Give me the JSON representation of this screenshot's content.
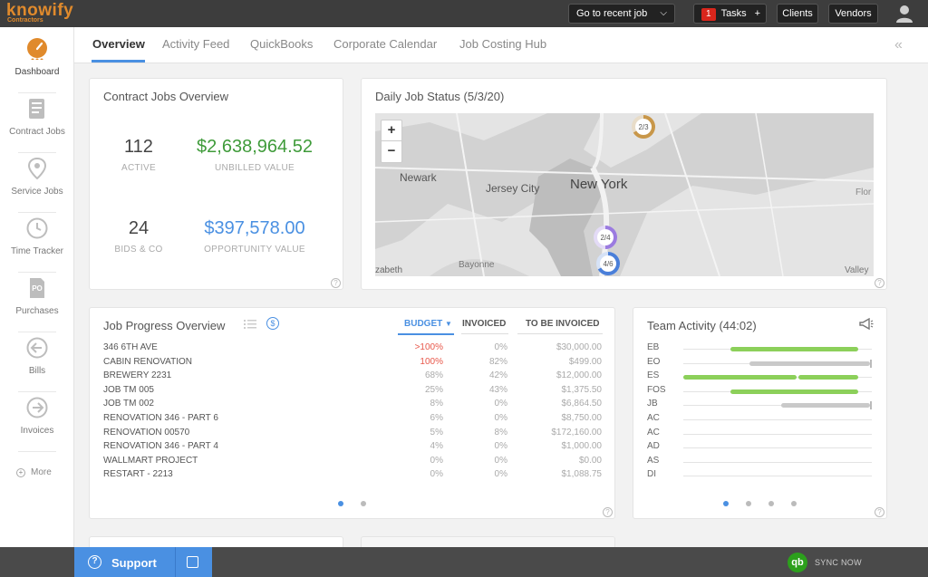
{
  "app": {
    "logo_text": "knowify",
    "logo_sub": "Contractors"
  },
  "topbar": {
    "recent_job_label": "Go to recent job",
    "tasks_count": "1",
    "tasks_label": "Tasks",
    "tasks_plus": "+",
    "clients_label": "Clients",
    "vendors_label": "Vendors"
  },
  "sidebar": {
    "items": [
      {
        "label": "Dashboard",
        "icon": "dashboard-gauge-icon"
      },
      {
        "label": "Contract Jobs",
        "icon": "document-dollar-icon"
      },
      {
        "label": "Service Jobs",
        "icon": "map-pin-icon"
      },
      {
        "label": "Time Tracker",
        "icon": "clock-icon"
      },
      {
        "label": "Purchases",
        "icon": "po-document-icon"
      },
      {
        "label": "Bills",
        "icon": "arrow-left-circle-icon"
      },
      {
        "label": "Invoices",
        "icon": "arrow-right-circle-icon"
      }
    ],
    "more_label": "More"
  },
  "tabs": [
    "Overview",
    "Activity Feed",
    "QuickBooks",
    "Corporate Calendar",
    "Job Costing Hub"
  ],
  "contract_jobs": {
    "title": "Contract Jobs Overview",
    "active_count": "112",
    "active_label": "ACTIVE",
    "unbilled_value": "$2,638,964.52",
    "unbilled_label": "UNBILLED VALUE",
    "bids_count": "24",
    "bids_label": "BIDS & CO",
    "opportunity_value": "$397,578.00",
    "opportunity_label": "OPPORTUNITY VALUE"
  },
  "daily_status": {
    "title": "Daily Job Status (5/3/20)",
    "zoom_in": "+",
    "zoom_out": "−",
    "map_labels": {
      "newark": "Newark",
      "jersey_city": "Jersey City",
      "new_york": "New York",
      "bayonne": "Bayonne",
      "elizabeth": "zabeth",
      "valley": "Valley",
      "flor": "Flor"
    },
    "markers": [
      {
        "label": "2/3",
        "done": 2,
        "total": 3,
        "color": "#c8974a"
      },
      {
        "label": "2/4",
        "done": 2,
        "total": 4,
        "color": "#9b7be0"
      },
      {
        "label": "4/6",
        "done": 4,
        "total": 6,
        "color": "#4a7fd9"
      }
    ]
  },
  "job_progress": {
    "title": "Job Progress Overview",
    "col_budget": "BUDGET",
    "col_invoiced": "INVOICED",
    "col_to_be_invoiced": "TO BE INVOICED",
    "rows": [
      {
        "name": "346 6TH AVE",
        "budget": ">100%",
        "invoiced": "0%",
        "to_be_invoiced": "$30,000.00",
        "over": true
      },
      {
        "name": "CABIN RENOVATION",
        "budget": "100%",
        "invoiced": "82%",
        "to_be_invoiced": "$499.00",
        "over": true
      },
      {
        "name": "BREWERY 2231",
        "budget": "68%",
        "invoiced": "42%",
        "to_be_invoiced": "$12,000.00",
        "over": false
      },
      {
        "name": "JOB TM 005",
        "budget": "25%",
        "invoiced": "43%",
        "to_be_invoiced": "$1,375.50",
        "over": false
      },
      {
        "name": "JOB TM 002",
        "budget": "8%",
        "invoiced": "0%",
        "to_be_invoiced": "$6,864.50",
        "over": false
      },
      {
        "name": "RENOVATION 346 - PART 6",
        "budget": "6%",
        "invoiced": "0%",
        "to_be_invoiced": "$8,750.00",
        "over": false
      },
      {
        "name": "RENOVATION 00570",
        "budget": "5%",
        "invoiced": "8%",
        "to_be_invoiced": "$172,160.00",
        "over": false
      },
      {
        "name": "RENOVATION 346 - PART 4",
        "budget": "4%",
        "invoiced": "0%",
        "to_be_invoiced": "$1,000.00",
        "over": false
      },
      {
        "name": "WALLMART PROJECT",
        "budget": "0%",
        "invoiced": "0%",
        "to_be_invoiced": "$0.00",
        "over": false
      },
      {
        "name": "RESTART - 2213",
        "budget": "0%",
        "invoiced": "0%",
        "to_be_invoiced": "$1,088.75",
        "over": false
      }
    ],
    "page": 1,
    "pages": 2
  },
  "team_activity": {
    "title": "Team Activity (44:02)",
    "rows": [
      {
        "initials": "EB",
        "segments": [
          {
            "start": 0.25,
            "end": 0.93,
            "color": "green"
          }
        ],
        "open": false
      },
      {
        "initials": "EO",
        "segments": [
          {
            "start": 0.35,
            "end": 0.99,
            "color": "gray"
          }
        ],
        "open": true
      },
      {
        "initials": "ES",
        "segments": [
          {
            "start": 0.0,
            "end": 0.6,
            "color": "green"
          },
          {
            "start": 0.61,
            "end": 0.93,
            "color": "green"
          }
        ],
        "open": false
      },
      {
        "initials": "FOS",
        "segments": [
          {
            "start": 0.25,
            "end": 0.93,
            "color": "green"
          }
        ],
        "open": false
      },
      {
        "initials": "JB",
        "segments": [
          {
            "start": 0.52,
            "end": 0.99,
            "color": "gray"
          }
        ],
        "open": true
      },
      {
        "initials": "AC",
        "segments": [],
        "open": false
      },
      {
        "initials": "AC",
        "segments": [],
        "open": false
      },
      {
        "initials": "AD",
        "segments": [],
        "open": false
      },
      {
        "initials": "AS",
        "segments": [],
        "open": false
      },
      {
        "initials": "DI",
        "segments": [],
        "open": false
      }
    ],
    "page": 1,
    "pages": 4
  },
  "bottom": {
    "support_label": "Support",
    "qb_icon_text": "qb",
    "sync_label": "SYNC NOW"
  },
  "colors": {
    "accent": "#4a90e2",
    "brand": "#e08a2c",
    "green_value": "#3f9b3a",
    "blue_value": "#4a90e2",
    "over_budget": "#e8574a"
  }
}
